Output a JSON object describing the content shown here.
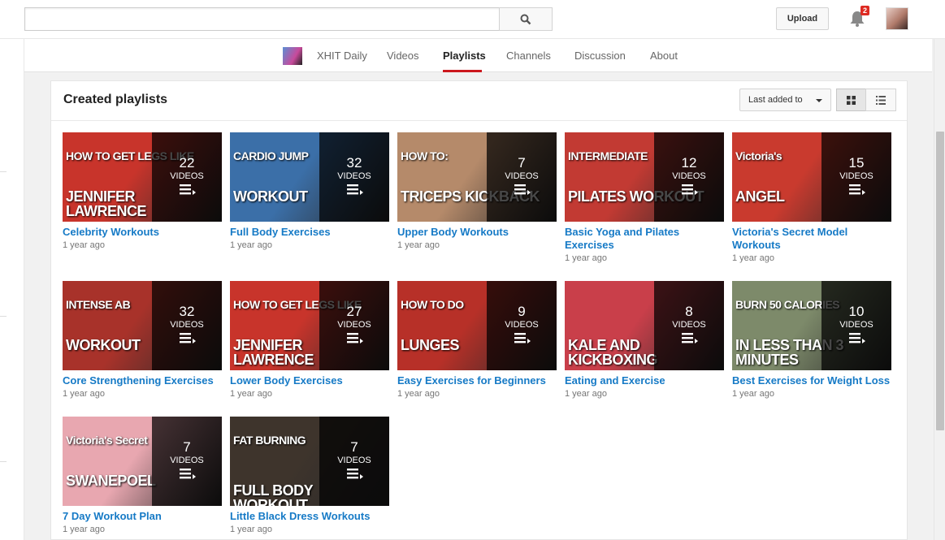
{
  "header": {
    "search_value": "",
    "upload_label": "Upload",
    "notification_count": "2"
  },
  "channel_nav": {
    "channel_name": "XHIT Daily",
    "tabs": [
      "Videos",
      "Playlists",
      "Channels",
      "Discussion",
      "About"
    ],
    "active_tab": "Playlists"
  },
  "section": {
    "title": "Created playlists",
    "sort_label": "Last added to"
  },
  "playlists": [
    {
      "title": "Celebrity Workouts",
      "count": "22",
      "count_label": "VIDEOS",
      "meta": "1 year ago",
      "thumb_lines": [
        "HOW TO GET LEGS LIKE",
        "JENNIFER LAWRENCE"
      ],
      "bg": "#c8342b"
    },
    {
      "title": "Full Body Exercises",
      "count": "32",
      "count_label": "VIDEOS",
      "meta": "1 year ago",
      "thumb_lines": [
        "CARDIO JUMP",
        "WORKOUT"
      ],
      "bg": "#3b6fa8"
    },
    {
      "title": "Upper Body Workouts",
      "count": "7",
      "count_label": "VIDEOS",
      "meta": "1 year ago",
      "thumb_lines": [
        "HOW TO:",
        "TRICEPS KICKBACK"
      ],
      "bg": "#b58a6a"
    },
    {
      "title": "Basic Yoga and Pilates Exercises",
      "count": "12",
      "count_label": "VIDEOS",
      "meta": "1 year ago",
      "thumb_lines": [
        "INTERMEDIATE",
        "PILATES WORKOUT"
      ],
      "bg": "#c23a33"
    },
    {
      "title": "Victoria's Secret Model Workouts",
      "count": "15",
      "count_label": "VIDEOS",
      "meta": "1 year ago",
      "thumb_lines": [
        "Victoria's",
        "ANGEL"
      ],
      "bg": "#c93a2e"
    },
    {
      "title": "Core Strengthening Exercises",
      "count": "32",
      "count_label": "VIDEOS",
      "meta": "1 year ago",
      "thumb_lines": [
        "INTENSE AB",
        "WORKOUT"
      ],
      "bg": "#a8322a"
    },
    {
      "title": "Lower Body Exercises",
      "count": "27",
      "count_label": "VIDEOS",
      "meta": "1 year ago",
      "thumb_lines": [
        "HOW TO GET LEGS LIKE",
        "JENNIFER LAWRENCE"
      ],
      "bg": "#c8342b"
    },
    {
      "title": "Easy Exercises for Beginners",
      "count": "9",
      "count_label": "VIDEOS",
      "meta": "1 year ago",
      "thumb_lines": [
        "HOW TO DO",
        "LUNGES"
      ],
      "bg": "#b73028"
    },
    {
      "title": "Eating and Exercise",
      "count": "8",
      "count_label": "VIDEOS",
      "meta": "1 year ago",
      "thumb_lines": [
        "",
        "KALE AND KICKBOXING"
      ],
      "bg": "#c93f4a"
    },
    {
      "title": "Best Exercises for Weight Loss",
      "count": "10",
      "count_label": "VIDEOS",
      "meta": "1 year ago",
      "thumb_lines": [
        "BURN 50 CALORIES",
        "IN LESS THAN 3 MINUTES"
      ],
      "bg": "#7d8a6a"
    },
    {
      "title": "7 Day Workout Plan",
      "count": "7",
      "count_label": "VIDEOS",
      "meta": "1 year ago",
      "thumb_lines": [
        "Victoria's Secret",
        "SWANEPOEL"
      ],
      "bg": "#e8a7b0"
    },
    {
      "title": "Little Black Dress Workouts",
      "count": "7",
      "count_label": "VIDEOS",
      "meta": "1 year ago",
      "thumb_lines": [
        "FAT BURNING",
        "FULL BODY WORKOUT"
      ],
      "bg": "#3e342c"
    }
  ]
}
